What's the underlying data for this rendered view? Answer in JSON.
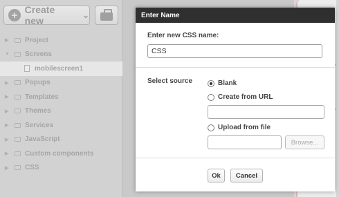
{
  "sidebar": {
    "create_button": {
      "label": "Create new"
    },
    "tree": [
      {
        "label": "Project",
        "expanded": false
      },
      {
        "label": "Screens",
        "expanded": true
      },
      {
        "label": "mobilescreen1",
        "child": true
      },
      {
        "label": "Popups",
        "expanded": false
      },
      {
        "label": "Templates",
        "expanded": false
      },
      {
        "label": "Themes",
        "expanded": false
      },
      {
        "label": "Services",
        "expanded": false
      },
      {
        "label": "JavaScript",
        "expanded": false
      },
      {
        "label": "Custom components",
        "expanded": false
      },
      {
        "label": "CSS",
        "expanded": false
      }
    ]
  },
  "dialog": {
    "title": "Enter Name",
    "name_label": "Enter new CSS name:",
    "name_value": "CSS",
    "source_label": "Select source",
    "options": [
      {
        "label": "Blank",
        "selected": true
      },
      {
        "label": "Create from URL",
        "selected": false
      },
      {
        "label": "Upload from file",
        "selected": false
      }
    ],
    "url_value": "",
    "file_value": "",
    "browse_label": "Browse...",
    "ok_label": "Ok",
    "cancel_label": "Cancel"
  },
  "colors": {
    "dialog_title_bg": "#2f2f2f",
    "sidebar_bg": "#d2d2d2",
    "overlay_bg": "#c9c9c9"
  }
}
